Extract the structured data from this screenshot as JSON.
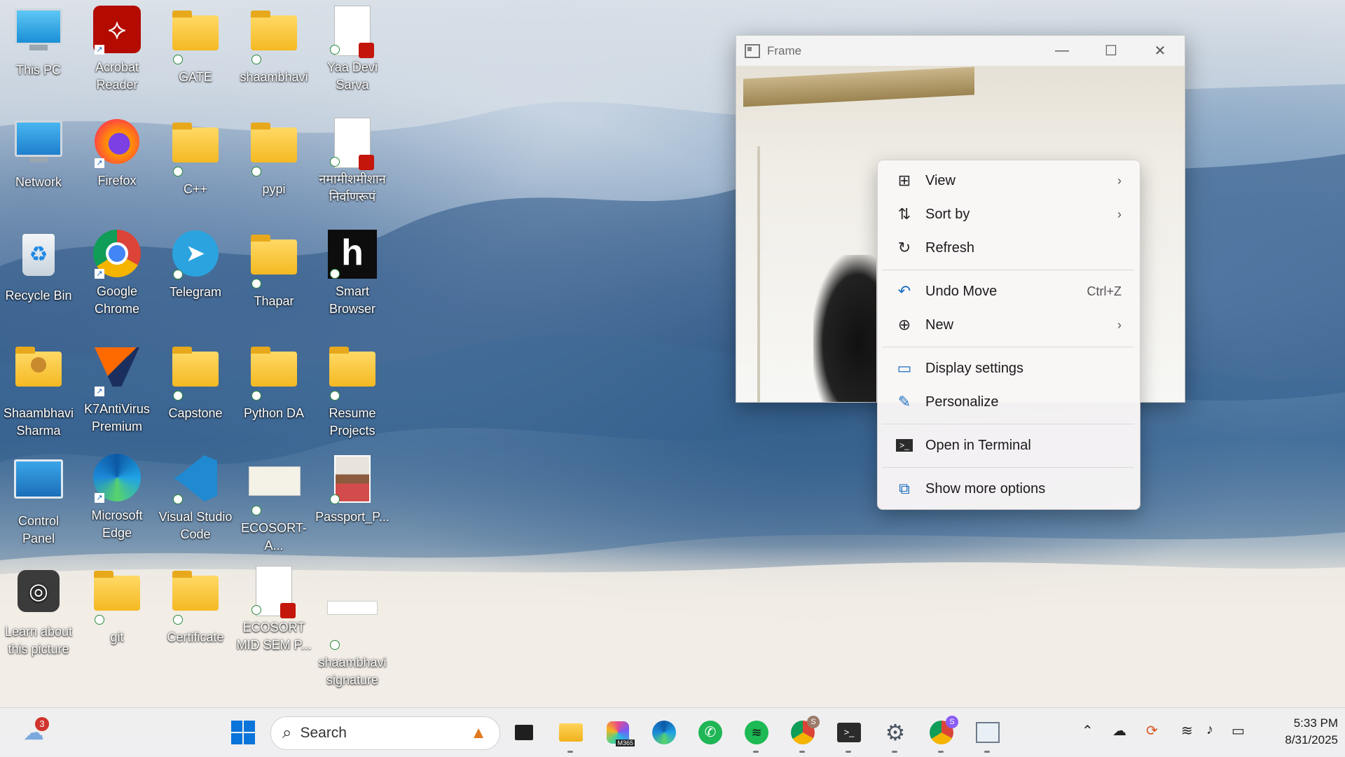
{
  "desktop": {
    "icons": [
      {
        "label": "This PC",
        "icon": "monitor-icon"
      },
      {
        "label": "Acrobat Reader",
        "icon": "acrobat-icon"
      },
      {
        "label": "GATE",
        "icon": "folder-icon"
      },
      {
        "label": "shaambhavi",
        "icon": "folder-icon"
      },
      {
        "label": "Yaa Devi Sarva",
        "icon": "pdf-file-icon"
      },
      {
        "label": "Network",
        "icon": "network-icon"
      },
      {
        "label": "Firefox",
        "icon": "firefox-icon"
      },
      {
        "label": "C++",
        "icon": "folder-icon"
      },
      {
        "label": "pypi",
        "icon": "folder-icon"
      },
      {
        "label": "नमामीशमीशान निर्वाणरूपं",
        "icon": "pdf-file-icon"
      },
      {
        "label": "Recycle Bin",
        "icon": "recycle-bin-icon"
      },
      {
        "label": "Google Chrome",
        "icon": "chrome-icon"
      },
      {
        "label": "Telegram",
        "icon": "telegram-icon"
      },
      {
        "label": "Thapar",
        "icon": "folder-icon"
      },
      {
        "label": "Smart Browser",
        "icon": "smart-browser-icon"
      },
      {
        "label": "Shaambhavi Sharma",
        "icon": "user-folder-icon"
      },
      {
        "label": "K7AntiVirus Premium",
        "icon": "k7-antivirus-icon"
      },
      {
        "label": "Capstone",
        "icon": "folder-icon"
      },
      {
        "label": "Python DA",
        "icon": "folder-icon"
      },
      {
        "label": "Resume Projects",
        "icon": "folder-icon"
      },
      {
        "label": "Control Panel",
        "icon": "control-panel-icon"
      },
      {
        "label": "Microsoft Edge",
        "icon": "edge-icon"
      },
      {
        "label": "Visual Studio Code",
        "icon": "vscode-icon"
      },
      {
        "label": "ECOSORT-A...",
        "icon": "pptx-file-icon"
      },
      {
        "label": "Passport_P...",
        "icon": "photo-file-icon"
      },
      {
        "label": "Learn about this picture",
        "icon": "learn-picture-icon"
      },
      {
        "label": "git",
        "icon": "folder-icon"
      },
      {
        "label": "Certificate",
        "icon": "folder-icon"
      },
      {
        "label": "ECOSORT MID SEM P...",
        "icon": "pdf-file-icon"
      },
      {
        "label": "shaambhavi signature",
        "icon": "image-file-icon"
      }
    ]
  },
  "frame_window": {
    "title": "Frame",
    "minimize": "—",
    "maximize": "☐",
    "close": "✕"
  },
  "context_menu": {
    "items": [
      {
        "label": "View",
        "icon": "view-grid-icon",
        "right": "›"
      },
      {
        "label": "Sort by",
        "icon": "sort-icon",
        "right": "›"
      },
      {
        "label": "Refresh",
        "icon": "refresh-icon",
        "right": ""
      },
      {
        "label": "Undo Move",
        "icon": "undo-icon",
        "right": "Ctrl+Z"
      },
      {
        "label": "New",
        "icon": "new-plus-icon",
        "right": "›"
      },
      {
        "label": "Display settings",
        "icon": "display-settings-icon",
        "right": ""
      },
      {
        "label": "Personalize",
        "icon": "brush-icon",
        "right": ""
      },
      {
        "label": "Open in Terminal",
        "icon": "terminal-icon",
        "right": ""
      },
      {
        "label": "Show more options",
        "icon": "show-more-icon",
        "right": ""
      }
    ]
  },
  "taskbar": {
    "weather_badge": "3",
    "search_placeholder": "Search",
    "chrome_profile_1": "S",
    "chrome_profile_2": "S",
    "copilot_label": "M365",
    "clock_time": "5:33 PM",
    "clock_date": "8/31/2025"
  }
}
